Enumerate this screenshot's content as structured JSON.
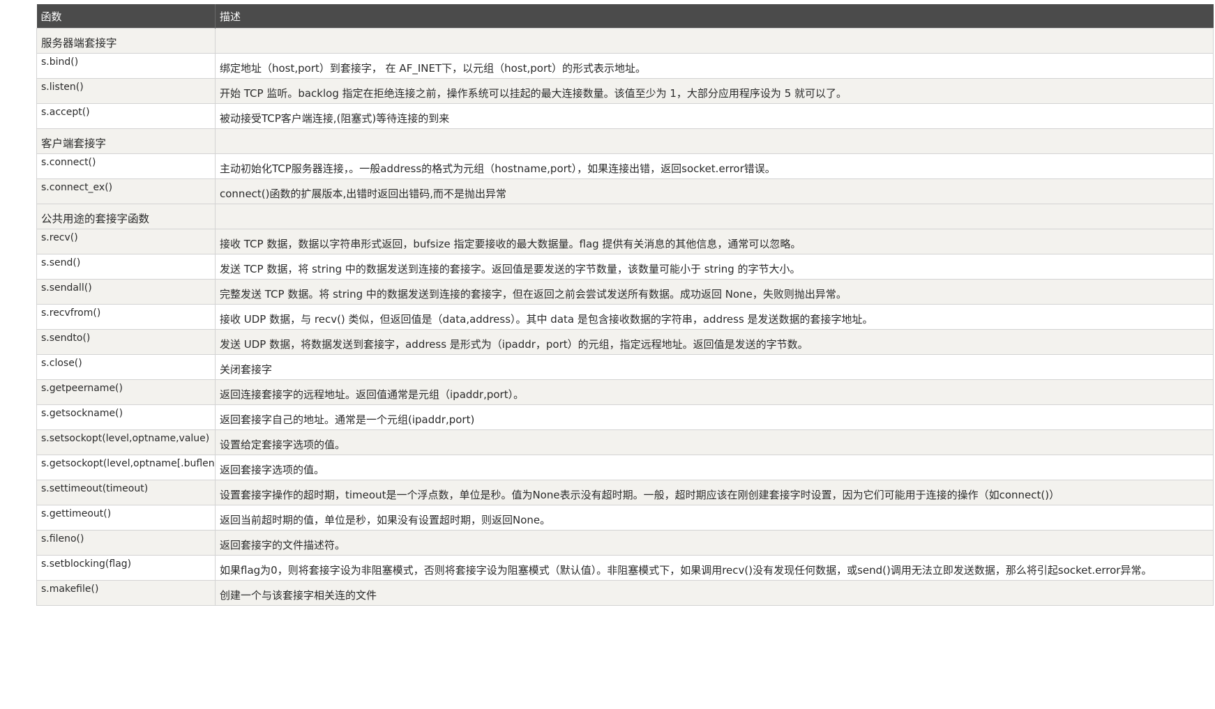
{
  "table": {
    "headers": [
      "函数",
      "描述"
    ],
    "rows": [
      {
        "type": "section",
        "fn": "服务器端套接字",
        "desc": ""
      },
      {
        "type": "row",
        "fn": "s.bind()",
        "desc": "绑定地址（host,port）到套接字， 在 AF_INET下，以元组（host,port）的形式表示地址。"
      },
      {
        "type": "row",
        "fn": "s.listen()",
        "desc": "开始 TCP 监听。backlog 指定在拒绝连接之前，操作系统可以挂起的最大连接数量。该值至少为 1，大部分应用程序设为 5 就可以了。"
      },
      {
        "type": "row",
        "fn": "s.accept()",
        "desc": "被动接受TCP客户端连接,(阻塞式)等待连接的到来"
      },
      {
        "type": "section",
        "fn": "客户端套接字",
        "desc": ""
      },
      {
        "type": "row",
        "fn": "s.connect()",
        "desc": "主动初始化TCP服务器连接，。一般address的格式为元组（hostname,port），如果连接出错，返回socket.error错误。"
      },
      {
        "type": "row",
        "fn": "s.connect_ex()",
        "desc": "connect()函数的扩展版本,出错时返回出错码,而不是抛出异常"
      },
      {
        "type": "section",
        "fn": "公共用途的套接字函数",
        "desc": ""
      },
      {
        "type": "row",
        "fn": "s.recv()",
        "desc": "接收 TCP 数据，数据以字符串形式返回，bufsize 指定要接收的最大数据量。flag 提供有关消息的其他信息，通常可以忽略。"
      },
      {
        "type": "row",
        "fn": "s.send()",
        "desc": "发送 TCP 数据，将 string 中的数据发送到连接的套接字。返回值是要发送的字节数量，该数量可能小于 string 的字节大小。"
      },
      {
        "type": "row",
        "fn": "s.sendall()",
        "desc": "完整发送 TCP 数据。将 string 中的数据发送到连接的套接字，但在返回之前会尝试发送所有数据。成功返回 None，失败则抛出异常。"
      },
      {
        "type": "row",
        "fn": "s.recvfrom()",
        "desc": "接收 UDP 数据，与 recv() 类似，但返回值是（data,address）。其中 data 是包含接收数据的字符串，address 是发送数据的套接字地址。"
      },
      {
        "type": "row",
        "fn": "s.sendto()",
        "desc": "发送 UDP 数据，将数据发送到套接字，address 是形式为（ipaddr，port）的元组，指定远程地址。返回值是发送的字节数。"
      },
      {
        "type": "row",
        "fn": "s.close()",
        "desc": "关闭套接字"
      },
      {
        "type": "row",
        "fn": "s.getpeername()",
        "desc": "返回连接套接字的远程地址。返回值通常是元组（ipaddr,port）。"
      },
      {
        "type": "row",
        "fn": "s.getsockname()",
        "desc": "返回套接字自己的地址。通常是一个元组(ipaddr,port)"
      },
      {
        "type": "row",
        "fn": "s.setsockopt(level,optname,value)",
        "desc": "设置给定套接字选项的值。"
      },
      {
        "type": "row",
        "fn": "s.getsockopt(level,optname[.buflen])",
        "desc": "返回套接字选项的值。"
      },
      {
        "type": "row",
        "fn": "s.settimeout(timeout)",
        "desc": "设置套接字操作的超时期，timeout是一个浮点数，单位是秒。值为None表示没有超时期。一般，超时期应该在刚创建套接字时设置，因为它们可能用于连接的操作（如connect()）"
      },
      {
        "type": "row",
        "fn": "s.gettimeout()",
        "desc": "返回当前超时期的值，单位是秒，如果没有设置超时期，则返回None。"
      },
      {
        "type": "row",
        "fn": "s.fileno()",
        "desc": "返回套接字的文件描述符。"
      },
      {
        "type": "row",
        "fn": "s.setblocking(flag)",
        "desc": "如果flag为0，则将套接字设为非阻塞模式，否则将套接字设为阻塞模式（默认值）。非阻塞模式下，如果调用recv()没有发现任何数据，或send()调用无法立即发送数据，那么将引起socket.error异常。"
      },
      {
        "type": "row",
        "fn": "s.makefile()",
        "desc": "创建一个与该套接字相关连的文件"
      }
    ]
  }
}
